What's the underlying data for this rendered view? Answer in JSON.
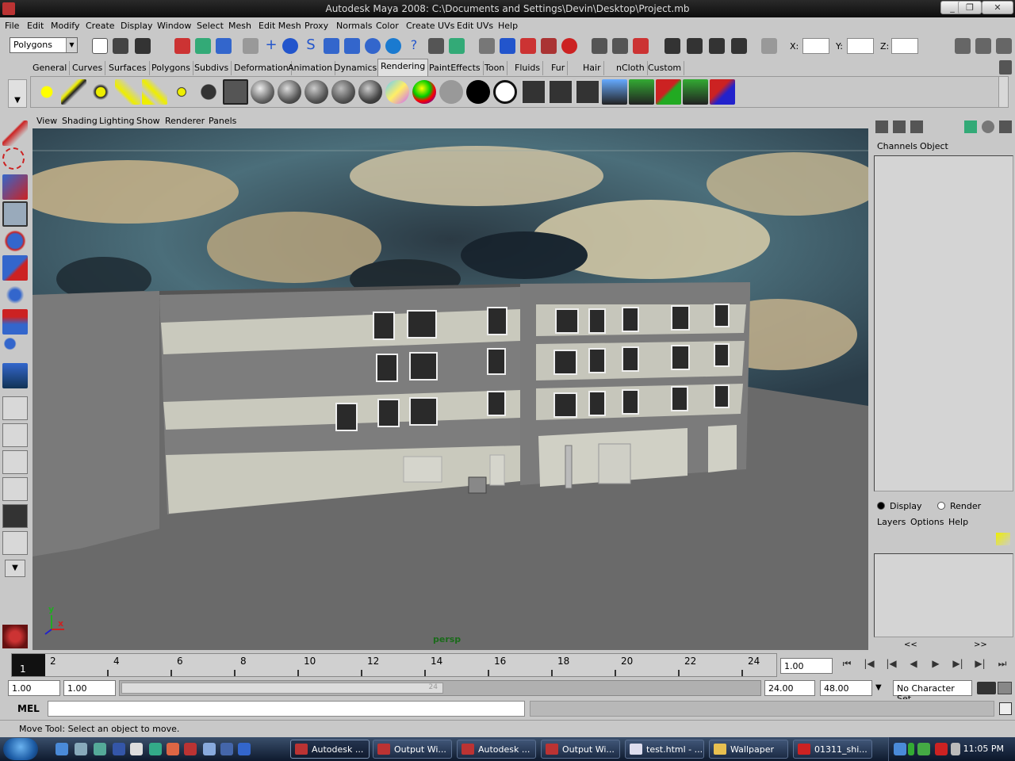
{
  "window": {
    "title": "Autodesk Maya 2008: C:\\Documents and Settings\\Devin\\Desktop\\Project.mb",
    "min": "_",
    "max": "❐",
    "close": "✕"
  },
  "menu": [
    "File",
    "Edit",
    "Modify",
    "Create",
    "Display",
    "Window",
    "Select",
    "Mesh",
    "Edit Mesh",
    "Proxy",
    "Normals",
    "Color",
    "Create UVs",
    "Edit UVs",
    "Help"
  ],
  "status": {
    "menuset": "Polygons",
    "x_label": "X:",
    "y_label": "Y:",
    "z_label": "Z:"
  },
  "shelf_tabs": [
    "General",
    "Curves",
    "Surfaces",
    "Polygons",
    "Subdivs",
    "Deformation",
    "Animation",
    "Dynamics",
    "Rendering",
    "PaintEffects",
    "Toon",
    "Fluids",
    "Fur",
    "Hair",
    "nCloth",
    "Custom"
  ],
  "active_shelf": "Rendering",
  "panel_menu": [
    "View",
    "Shading",
    "Lighting",
    "Show",
    "Renderer",
    "Panels"
  ],
  "viewport": {
    "camera": "persp",
    "axis_x": "x",
    "axis_y": "y"
  },
  "channel_box": {
    "tabs": [
      "Channels",
      "Object"
    ]
  },
  "layer_editor": {
    "display": "Display",
    "render": "Render",
    "menu": [
      "Layers",
      "Options",
      "Help"
    ],
    "scroll_left": "<<",
    "scroll_right": ">>"
  },
  "timeline": {
    "current_frame": "1",
    "ticks": [
      "2",
      "4",
      "6",
      "8",
      "10",
      "12",
      "14",
      "16",
      "18",
      "20",
      "22",
      "24"
    ],
    "current_time": "1.00",
    "playback": [
      "⏮",
      "|◀",
      "|◀",
      "◀",
      "▶",
      "▶|",
      "▶|",
      "⏭"
    ]
  },
  "range": {
    "start": "1.00",
    "anim_start": "1.00",
    "slider_end_label": "24",
    "playback_end": "24.00",
    "anim_end": "48.00",
    "character_set": "No Character Set"
  },
  "mel": {
    "label": "MEL"
  },
  "help_line": "Move Tool: Select an object to move.",
  "taskbar": {
    "tasks": [
      {
        "label": "Autodesk ...",
        "active": true
      },
      {
        "label": "Output Wi...",
        "active": false
      },
      {
        "label": "Autodesk ...",
        "active": false
      },
      {
        "label": "Output Wi...",
        "active": false
      },
      {
        "label": "test.html - ...",
        "active": false
      },
      {
        "label": "Wallpaper",
        "active": false
      },
      {
        "label": "01311_shi...",
        "active": false
      }
    ],
    "clock": "11:05 PM"
  },
  "colors": {
    "maya_gray": "#c8c8c8",
    "viewport_ground": "#6a6a6a",
    "persp_label": "#1a6a1a"
  }
}
